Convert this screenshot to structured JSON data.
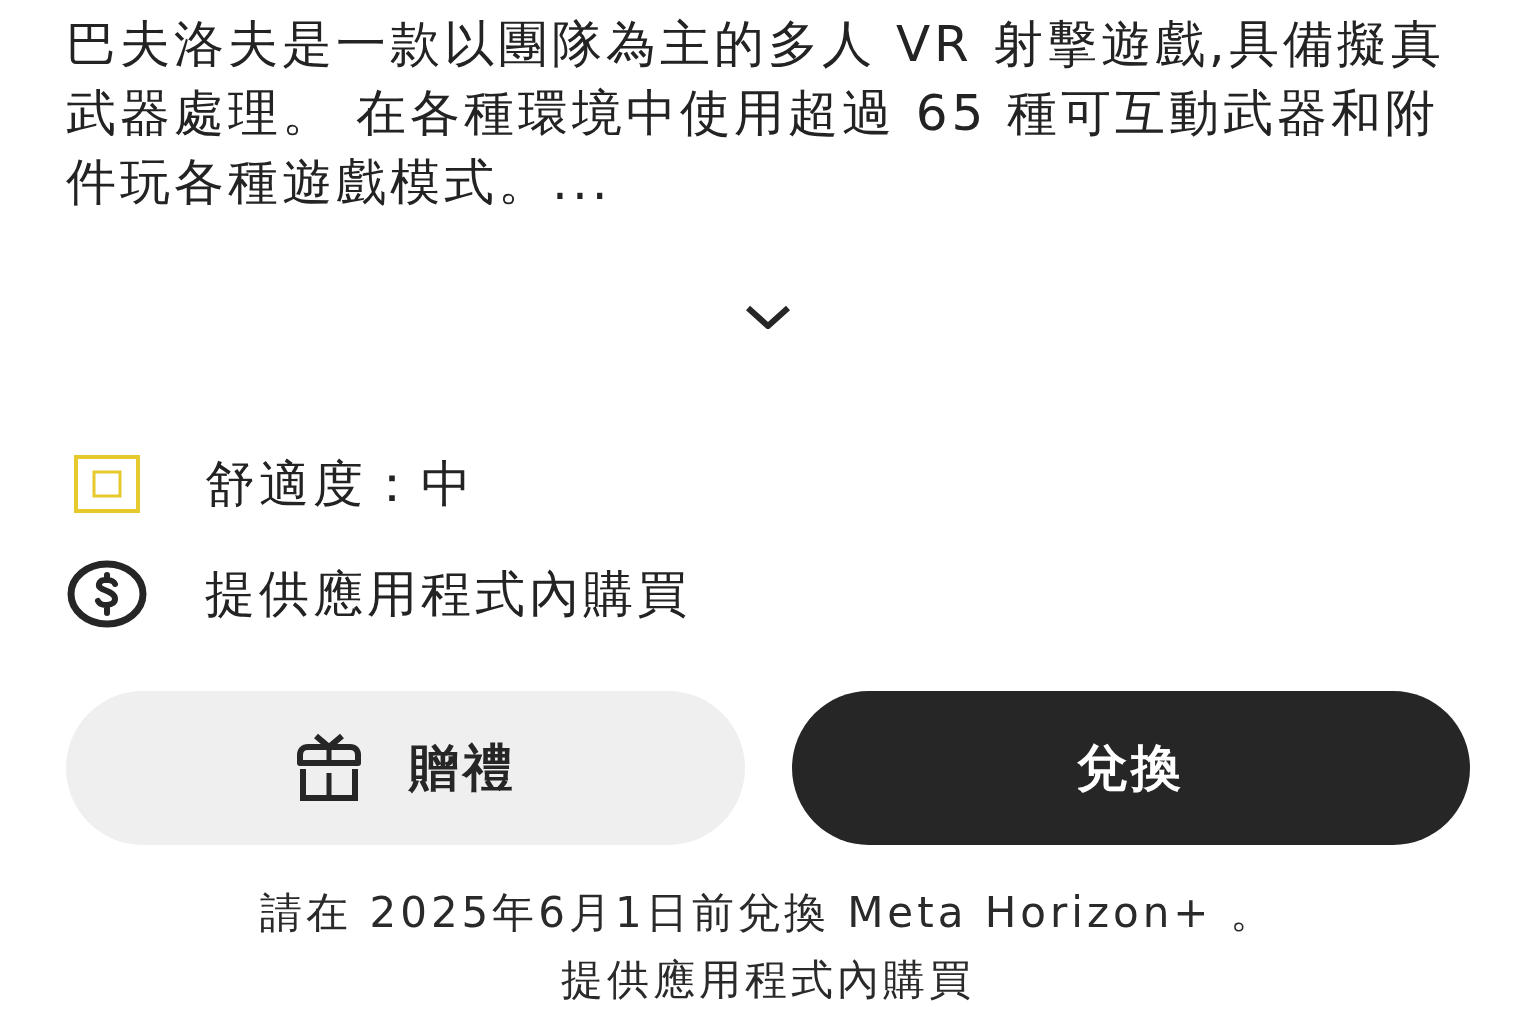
{
  "description": {
    "text": "巴夫洛夫是一款以團隊為主的多人 VR 射擊遊戲,具備擬真武器處理。 在各種環境中使用超過 65 種可互動武器和附件玩各種遊戲模式。...",
    "expanded": false
  },
  "features": [
    {
      "kind": "comfort",
      "text": "舒適度：中",
      "color": "#e6c92c"
    },
    {
      "kind": "purchases",
      "text": "提供應用程式內購買"
    }
  ],
  "buttons": [
    {
      "kind": "gift",
      "label": "贈禮"
    },
    {
      "kind": "primary",
      "label": "兌換"
    }
  ],
  "footer": {
    "note": "請在 2025年6月1日前兌換 Meta Horizon+ 。",
    "purchases": "提供應用程式內購買"
  }
}
